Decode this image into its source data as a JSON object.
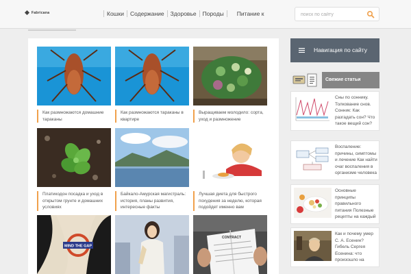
{
  "header": {
    "logo_text": "Fabricana",
    "nav": [
      "Кошки",
      "Содержание",
      "Здоровье",
      "Породы",
      "Питание к"
    ],
    "search_placeholder": "поиск по сайту"
  },
  "articles": [
    {
      "caption": "Как размножаются домашние тараканы",
      "image": "cockroach-photo"
    },
    {
      "caption": "Как размножаются тараканы в квартире",
      "image": "cockroach-photo"
    },
    {
      "caption": "Выращиваем молодило: сорта, уход и размножение",
      "image": "succulent-garden-photo"
    },
    {
      "caption": "Платикодон посадка и уход в открытом грунте и домашних условиях",
      "image": "plant-sprout-photo"
    },
    {
      "caption": "Байкало-Амурская магистраль: история, планы развития, интересные факты",
      "image": "landscape-photo"
    },
    {
      "caption": "Лучшая диета для быстрого похудения за неделю, которая подойдет именно вам",
      "image": "girl-diet-photo"
    },
    {
      "caption": "",
      "image": "mind-the-gap-photo",
      "overlay_text": "MIND THE GAP"
    },
    {
      "caption": "",
      "image": "woman-photo"
    },
    {
      "caption": "",
      "image": "contract-photo",
      "overlay_text": "CONTRACT"
    }
  ],
  "sidebar": {
    "nav_title": "Навигация по сайту",
    "fresh_title": "Свежие статьи",
    "posts": [
      {
        "text": "Сны по соннику. Толкование снов. Сонник: Как разгадать сон? Что такое вещий сон? Как толковать сны?",
        "image": "chart-thumbnail"
      },
      {
        "text": "Воспаление: причины, симптомы и лечение Как найти очаг воспаления в организме человека",
        "image": "diagram-thumbnail"
      },
      {
        "text": "Основные принципы правильного питания Полезные рецепты на каждый день для здоровья",
        "image": "healthy-food-thumbnail"
      },
      {
        "text": "Как и почему умер С. А. Есенин? Гибель Сергея Есенина: что произошло на самом деле. Есенин смерть информация и",
        "image": "esenin-thumbnail"
      }
    ]
  },
  "colors": {
    "accent": "#f0a04b",
    "nav_box": "#5a6571",
    "fresh_bar": "#858585"
  }
}
